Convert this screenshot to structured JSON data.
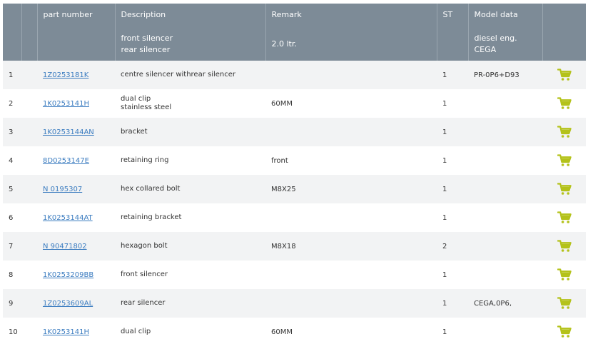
{
  "columns": {
    "index": "",
    "spacer": "",
    "part_number": "part number",
    "description": "Description",
    "remark": "Remark",
    "st": "ST",
    "model_data": "Model data",
    "cart": ""
  },
  "subheader": {
    "description_line1": "front silencer",
    "description_line2": "rear silencer",
    "remark": "2.0 ltr.",
    "model_line1": "diesel eng.",
    "model_line2": "CEGA"
  },
  "colors": {
    "header_bg": "#7d8b97",
    "row_alt_bg": "#f2f3f4",
    "link": "#3b7cc0",
    "cart_icon": "#b4c21a"
  },
  "rows": [
    {
      "index": "1",
      "part_number": "1Z0253181K",
      "description": [
        "centre silencer withrear silencer"
      ],
      "remark": "",
      "st": "1",
      "model": "PR-0P6+D93",
      "cart_icon": "cart-icon"
    },
    {
      "index": "2",
      "part_number": "1K0253141H",
      "description": [
        "dual clip",
        "stainless steel"
      ],
      "remark": "60MM",
      "st": "1",
      "model": "",
      "cart_icon": "cart-icon"
    },
    {
      "index": "3",
      "part_number": "1K0253144AN",
      "description": [
        "bracket"
      ],
      "remark": "",
      "st": "1",
      "model": "",
      "cart_icon": "cart-icon"
    },
    {
      "index": "4",
      "part_number": "8D0253147E",
      "description": [
        "retaining ring"
      ],
      "remark": "front",
      "st": "1",
      "model": "",
      "cart_icon": "cart-icon"
    },
    {
      "index": "5",
      "part_number": "N 0195307",
      "description": [
        "hex collared bolt"
      ],
      "remark": "M8X25",
      "st": "1",
      "model": "",
      "cart_icon": "cart-icon"
    },
    {
      "index": "6",
      "part_number": "1K0253144AT",
      "description": [
        "retaining bracket"
      ],
      "remark": "",
      "st": "1",
      "model": "",
      "cart_icon": "cart-icon"
    },
    {
      "index": "7",
      "part_number": "N 90471802",
      "description": [
        "hexagon bolt"
      ],
      "remark": "M8X18",
      "st": "2",
      "model": "",
      "cart_icon": "cart-icon"
    },
    {
      "index": "8",
      "part_number": "1K0253209BB",
      "description": [
        "front silencer"
      ],
      "remark": "",
      "st": "1",
      "model": "",
      "cart_icon": "cart-icon"
    },
    {
      "index": "9",
      "part_number": "1Z0253609AL",
      "description": [
        "rear silencer"
      ],
      "remark": "",
      "st": "1",
      "model": "CEGA,0P6,",
      "cart_icon": "cart-icon"
    },
    {
      "index": "10",
      "part_number": "1K0253141H",
      "description": [
        "dual clip"
      ],
      "remark": "60MM",
      "st": "1",
      "model": "",
      "cart_icon": "cart-icon"
    }
  ]
}
